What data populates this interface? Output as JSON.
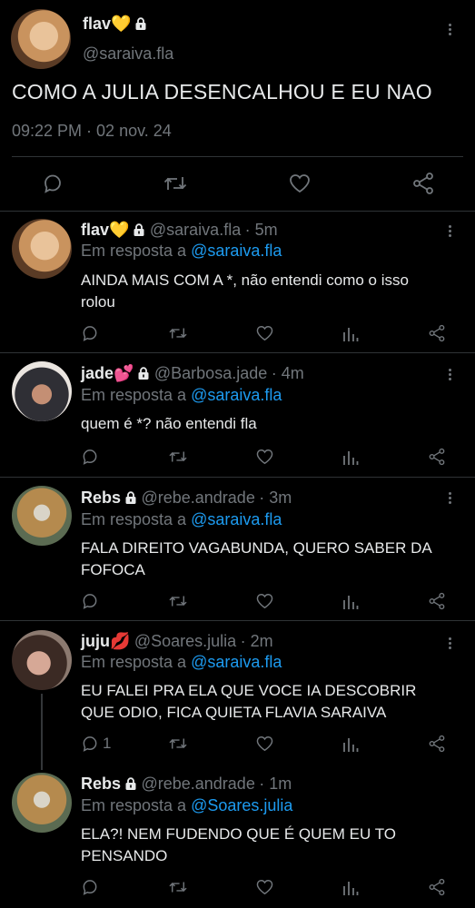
{
  "main_tweet": {
    "name": "flav💛",
    "handle": "@saraiva.fla",
    "text": "COMO A JULIA DESENCALHOU E EU NAO",
    "timestamp": "09:22 PM · 02 nov. 24"
  },
  "replies": [
    {
      "name": "flav💛",
      "handle": "@saraiva.fla",
      "time": "· 5m",
      "reply_prefix": "Em resposta a",
      "reply_to": "@saraiva.fla",
      "text_line1": "AINDA MAIS COM A *, não entendi como o isso",
      "text_line2": "rolou"
    },
    {
      "name": "jade💕",
      "handle": "@Barbosa.jade",
      "time": "· 4m",
      "reply_prefix": "Em resposta a",
      "reply_to": "@saraiva.fla",
      "text_line1": "quem é *? não entendi fla"
    },
    {
      "name": "Rebs",
      "handle": "@rebe.andrade",
      "time": "· 3m",
      "reply_prefix": "Em resposta a",
      "reply_to": "@saraiva.fla",
      "text_line1": "FALA DIREITO VAGABUNDA, QUERO SABER DA",
      "text_line2": "FOFOCA"
    },
    {
      "name": "juju💋",
      "handle": "@Soares.julia",
      "time": "· 2m",
      "reply_prefix": "Em resposta a",
      "reply_to": "@saraiva.fla",
      "text_line1": "EU FALEI PRA ELA QUE VOCE IA DESCOBRIR",
      "text_line2": "QUE ODIO, FICA QUIETA FLAVIA SARAIVA",
      "reply_count": "1"
    },
    {
      "name": "Rebs",
      "handle": "@rebe.andrade",
      "time": "· 1m",
      "reply_prefix": "Em resposta a",
      "reply_to": "@Soares.julia",
      "text_line1": "ELA?! NEM FUDENDO QUE É QUEM EU TO",
      "text_line2": "PENSANDO"
    }
  ],
  "icons": {
    "reply": "reply-icon",
    "retweet": "retweet-icon",
    "like": "heart-icon",
    "share": "share-icon",
    "stats": "stats-icon",
    "lock": "lock-icon",
    "more": "more-icon"
  },
  "colors": {
    "background": "#000000",
    "text": "#e7e9ea",
    "muted": "#71767b",
    "link": "#1d9bf0",
    "divider": "#2f3336"
  }
}
